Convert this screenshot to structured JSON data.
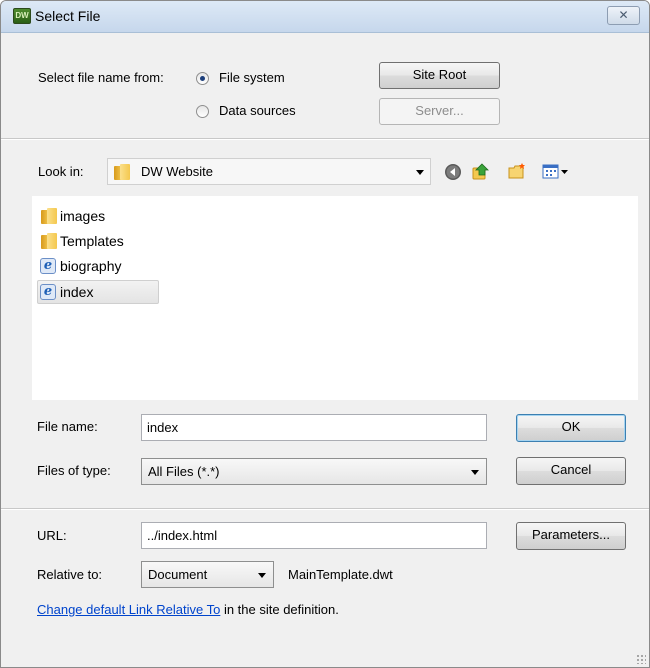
{
  "window": {
    "title": "Select File",
    "logo_text": "DW",
    "close_glyph": "✕"
  },
  "source": {
    "label": "Select file name from:",
    "options": [
      "File system",
      "Data sources"
    ],
    "selected": "File system",
    "site_root_button": "Site Root",
    "server_button": "Server..."
  },
  "browser": {
    "look_in_label": "Look in:",
    "look_in_value": "DW Website",
    "toolbar_icons": [
      "back-icon",
      "up-folder-icon",
      "new-folder-icon",
      "view-menu-icon"
    ],
    "files": [
      {
        "name": "images",
        "type": "folder",
        "selected": false
      },
      {
        "name": "Templates",
        "type": "folder",
        "selected": false
      },
      {
        "name": "biography",
        "type": "html",
        "selected": false
      },
      {
        "name": "index",
        "type": "html",
        "selected": true
      }
    ]
  },
  "form": {
    "file_name_label": "File name:",
    "file_name_value": "index",
    "files_of_type_label": "Files of type:",
    "files_of_type_value": "All Files (*.*)",
    "ok_button": "OK",
    "cancel_button": "Cancel",
    "url_label": "URL:",
    "url_value": "../index.html",
    "parameters_button": "Parameters...",
    "relative_to_label": "Relative to:",
    "relative_to_value": "Document",
    "template_name": "MainTemplate.dwt",
    "link_text": "Change default Link Relative To",
    "link_suffix": " in the site definition."
  },
  "colors": {
    "titlebar": "#c6d7ec",
    "dialog_bg": "#f0f0f0",
    "link": "#0044cc",
    "folder": "#f4c84f"
  }
}
